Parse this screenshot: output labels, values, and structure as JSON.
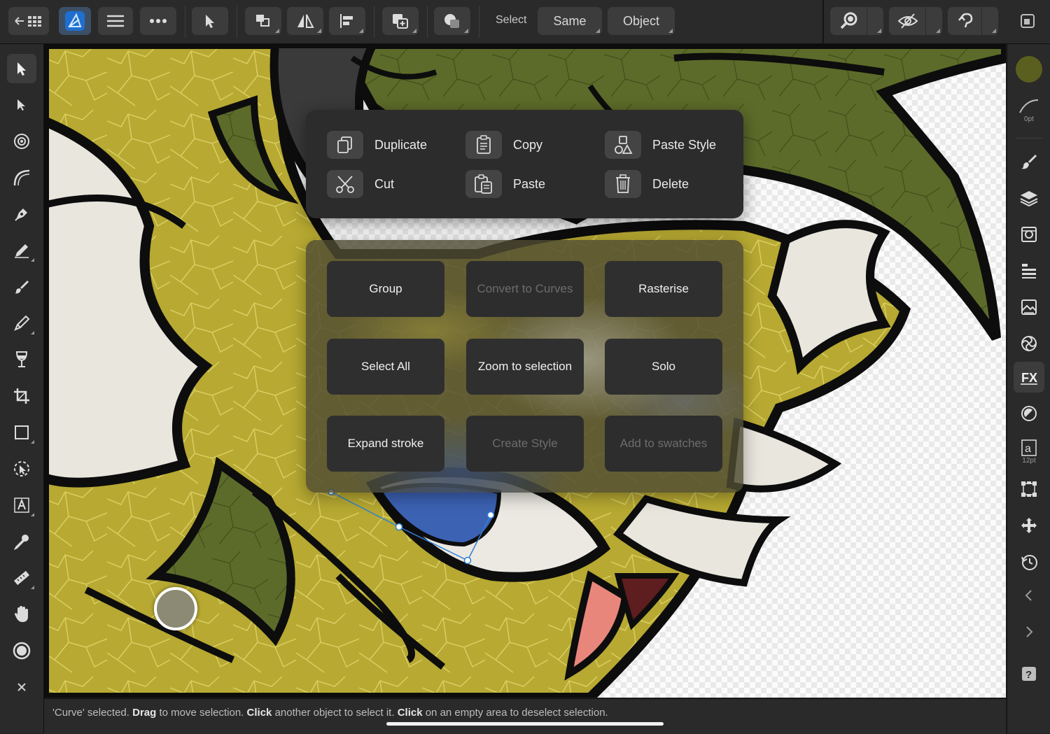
{
  "toolbar": {
    "select_label": "Select",
    "same_label": "Same",
    "object_label": "Object"
  },
  "context_menu": {
    "items": [
      {
        "label": "Duplicate",
        "icon": "duplicate-icon"
      },
      {
        "label": "Copy",
        "icon": "copy-icon"
      },
      {
        "label": "Paste Style",
        "icon": "paste-style-icon"
      },
      {
        "label": "Cut",
        "icon": "scissors-icon"
      },
      {
        "label": "Paste",
        "icon": "paste-icon"
      },
      {
        "label": "Delete",
        "icon": "trash-icon"
      }
    ]
  },
  "quick_actions": {
    "buttons": [
      {
        "label": "Group",
        "enabled": true
      },
      {
        "label": "Convert to Curves",
        "enabled": false
      },
      {
        "label": "Rasterise",
        "enabled": true
      },
      {
        "label": "Select All",
        "enabled": true
      },
      {
        "label": "Zoom to selection",
        "enabled": true
      },
      {
        "label": "Solo",
        "enabled": true
      },
      {
        "label": "Expand stroke",
        "enabled": true
      },
      {
        "label": "Create Style",
        "enabled": false
      },
      {
        "label": "Add to swatches",
        "enabled": false
      }
    ]
  },
  "right_studio": {
    "stroke_width": "0pt",
    "text_size": "12pt",
    "fill_color": "#5a5f1f"
  },
  "status": {
    "part1": "'Curve' selected. ",
    "drag": "Drag",
    "part2": " to move selection. ",
    "click1": "Click",
    "part3": " another object to select it. ",
    "click2": "Click",
    "part4": " on an empty area to deselect selection."
  },
  "colors": {
    "accent": "#2f7fd6",
    "body_yellow": "#b7a932",
    "leaf_green": "#5d6b2a",
    "eye_blue": "#3c62b4",
    "tongue_pink": "#e9867b"
  }
}
